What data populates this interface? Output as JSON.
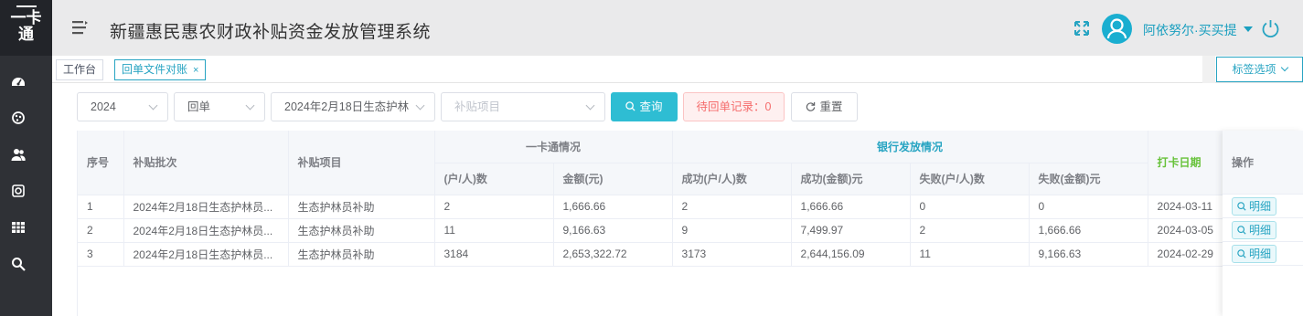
{
  "app": {
    "logo_top": "一卡",
    "logo_bottom": "通",
    "title": "新疆惠民惠农财政补贴资金发放管理系统",
    "username": "阿依努尔·买买提",
    "brand_color": "#27a4c2"
  },
  "sidebar": {
    "icons": [
      "dashboard-icon",
      "palette-icon",
      "users-icon",
      "disc-icon",
      "grid-icon",
      "search-icon"
    ]
  },
  "tabs": [
    {
      "label": "工作台"
    },
    {
      "label": "回单文件对账",
      "close": "×"
    }
  ],
  "tab_options": "标签选项",
  "filters": {
    "year": "2024",
    "type": "回单",
    "batch": "2024年2月18日生态护林",
    "project_placeholder": "补贴项目",
    "query": "查询",
    "pending": "待回单记录：0",
    "reset": "重置"
  },
  "table": {
    "headers": {
      "seq": "序号",
      "batch": "补贴批次",
      "project": "补贴项目",
      "card_group": "一卡通情况",
      "bank_group": "银行发放情况",
      "card_date": "打卡日期",
      "operation": "操作",
      "households": "(户/人)数",
      "amount": "金额(元)",
      "success_households": "成功(户/人)数",
      "success_amount": "成功(金额)元",
      "fail_households": "失败(户/人)数",
      "fail_amount": "失败(金额)元"
    },
    "rows": [
      {
        "seq": "1",
        "batch": "2024年2月18日生态护林员...",
        "project": "生态护林员补助",
        "households": "2",
        "amount": "1,666.66",
        "success_households": "2",
        "success_amount": "1,666.66",
        "fail_households": "0",
        "fail_amount": "0",
        "date": "2024-03-11",
        "action": "明细"
      },
      {
        "seq": "2",
        "batch": "2024年2月18日生态护林员...",
        "project": "生态护林员补助",
        "households": "11",
        "amount": "9,166.63",
        "success_households": "9",
        "success_amount": "7,499.97",
        "fail_households": "2",
        "fail_amount": "1,666.66",
        "date": "2024-03-05",
        "action": "明细"
      },
      {
        "seq": "3",
        "batch": "2024年2月18日生态护林员...",
        "project": "生态护林员补助",
        "households": "3184",
        "amount": "2,653,322.72",
        "success_households": "3173",
        "success_amount": "2,644,156.09",
        "fail_households": "11",
        "fail_amount": "9,166.63",
        "date": "2024-02-29",
        "action": "明细"
      }
    ]
  }
}
